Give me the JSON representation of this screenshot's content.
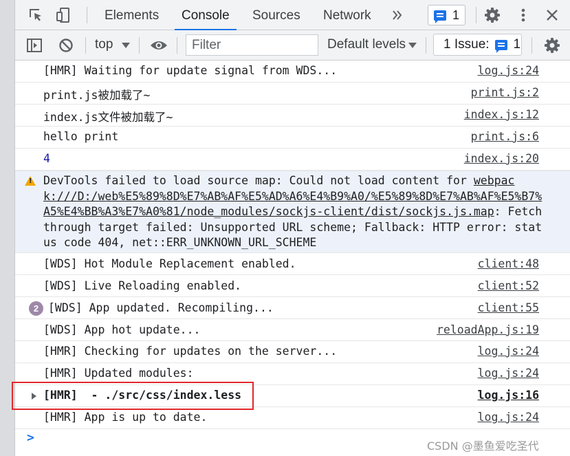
{
  "tabs": [
    {
      "label": "Elements"
    },
    {
      "label": "Console"
    },
    {
      "label": "Sources"
    },
    {
      "label": "Network"
    }
  ],
  "more_tabs_icon": "double-chevron-right-icon",
  "message_count": "1",
  "toolbar": {
    "context": "top",
    "filter_placeholder": "Filter",
    "levels": "Default levels",
    "issues_label": "1 Issue:",
    "issues_count": "1"
  },
  "messages": [
    {
      "text": "[HMR] Waiting for update signal from WDS...",
      "source": "log.js:24"
    },
    {
      "text": "print.js被加载了~",
      "source": "print.js:2"
    },
    {
      "text": "index.js文件被加载了~",
      "source": "index.js:12"
    },
    {
      "text": "hello print",
      "source": "print.js:6"
    },
    {
      "text": "4",
      "source": "index.js:20"
    },
    {
      "warning_prefix": "DevTools failed to load source map: Could not load content for ",
      "warning_link": "webpack:///D:/web%E5%89%8D%E7%AB%AF%E5%AD%A6%E4%B9%A0/%E5%89%8D%E7%AB%AF%E5%B7%A5%E4%BB%A3%E7%A0%81/node_modules/sockjs-client/dist/sockjs.js.map",
      "warning_suffix": ": Fetch through target failed: Unsupported URL scheme; Fallback: HTTP error: status code 404, net::ERR_UNKNOWN_URL_SCHEME"
    },
    {
      "text": "[WDS] Hot Module Replacement enabled.",
      "source": "client:48"
    },
    {
      "text": "[WDS] Live Reloading enabled.",
      "source": "client:52"
    },
    {
      "repeat": "2",
      "text": "[WDS] App updated. Recompiling...",
      "source": "client:55"
    },
    {
      "text": "[WDS] App hot update...",
      "source": "reloadApp.js:19"
    },
    {
      "text": "[HMR] Checking for updates on the server...",
      "source": "log.js:24"
    },
    {
      "text": "[HMR] Updated modules:",
      "source": "log.js:24"
    },
    {
      "text": "[HMR]  - ./src/css/index.less",
      "source": "log.js:16"
    },
    {
      "text": "[HMR] App is up to date.",
      "source": "log.js:24"
    }
  ],
  "prompt": ">",
  "watermark": "CSDN @墨鱼爱吃圣代",
  "colors": {
    "accent": "#1a73e8",
    "warning_bg": "#edf2fa",
    "highlight": "#e0282c",
    "number": "#1a1aa6"
  }
}
